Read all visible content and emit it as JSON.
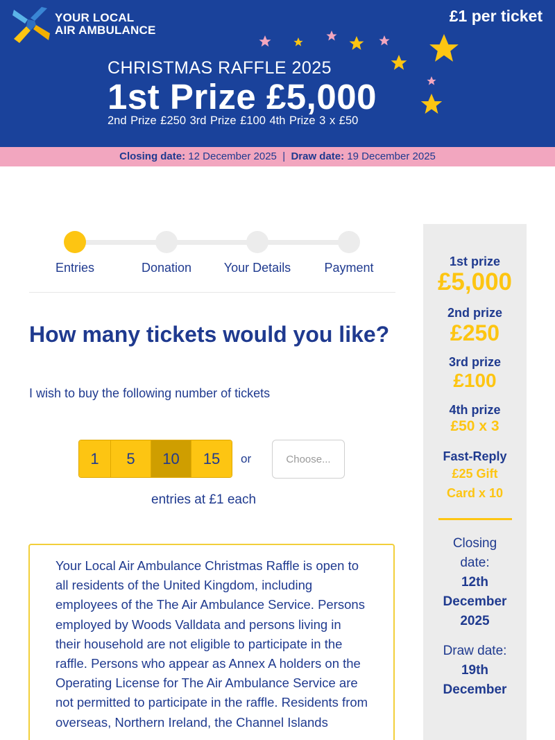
{
  "header": {
    "logo_line1": "YOUR LOCAL",
    "logo_line2": "AIR AMBULANCE",
    "price": "£1 per ticket",
    "raffle_title": "CHRISTMAS RAFFLE 2025",
    "first_prize": "1st Prize £5,000",
    "other_prizes": "2nd Prize £250  3rd Prize  £100  4th Prize 3 x £50",
    "colors": {
      "banner": "#1a429b",
      "star_yellow": "#fdc512",
      "star_pink": "#f2a6bf"
    }
  },
  "dates": {
    "closing_label": "Closing date:",
    "closing_value": " 12 December 2025",
    "separator": "  |  ",
    "draw_label": "Draw date:",
    "draw_value": " 19 December 2025"
  },
  "steps": [
    {
      "label": "Entries",
      "active": true
    },
    {
      "label": "Donation",
      "active": false
    },
    {
      "label": "Your Details",
      "active": false
    },
    {
      "label": "Payment",
      "active": false
    }
  ],
  "form": {
    "question": "How many tickets would you like?",
    "wish": "I wish to buy the following number of tickets",
    "quantities": [
      "1",
      "5",
      "10",
      "15"
    ],
    "selected_quantity": "10",
    "or": "or",
    "choose_placeholder": "Choose...",
    "entries_note": "entries at £1 each"
  },
  "terms": "Your Local Air Ambulance Christmas Raffle is open to all residents of the United Kingdom, including employees of the The Air Ambulance Service. Persons employed by Woods Valldata and persons living in their household are not eligible to participate in the raffle. Persons who appear as Annex A holders on the Operating License for The Air Ambulance Service are not permitted to participate in the raffle. Residents from overseas, Northern Ireland, the Channel Islands",
  "sidebar": {
    "first_label": "1st prize",
    "first_value": "£5,000",
    "second_label": "2nd prize",
    "second_value": "£250",
    "third_label": "3rd prize",
    "third_value": "£100",
    "fourth_label": "4th prize",
    "fourth_value": "£50 x 3",
    "fast_label": "Fast-Reply",
    "fast_value_1": "£25 Gift",
    "fast_value_2": "Card x 10",
    "closing_label_1": "Closing",
    "closing_label_2": "date:",
    "closing_1": "12th",
    "closing_2": "December",
    "closing_3": "2025",
    "draw_label": "Draw date:",
    "draw_1": "19th",
    "draw_2": "December"
  }
}
